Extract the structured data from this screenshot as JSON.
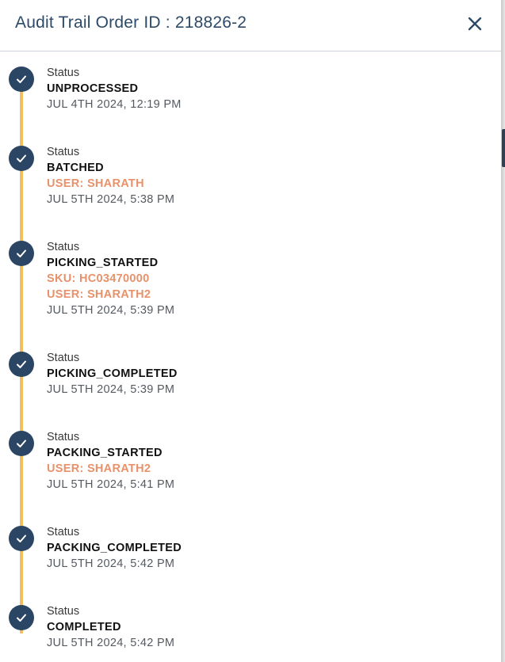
{
  "header": {
    "title": "Audit Trail Order ID : 218826-2",
    "close_icon": "close-icon"
  },
  "colors": {
    "title": "#2d4a66",
    "timeline_line": "#f0c060",
    "check_circle": "#2b4565",
    "user_sku_text": "#e8916a"
  },
  "entries": [
    {
      "label": "Status",
      "status": "UNPROCESSED",
      "details": [],
      "date": "JUL 4TH 2024, 12:19 PM"
    },
    {
      "label": "Status",
      "status": "BATCHED",
      "details": [
        "USER: SHARATH"
      ],
      "date": "JUL 5TH 2024, 5:38 PM"
    },
    {
      "label": "Status",
      "status": "PICKING_STARTED",
      "details": [
        "SKU: HC03470000",
        "USER: SHARATH2"
      ],
      "date": "JUL 5TH 2024, 5:39 PM"
    },
    {
      "label": "Status",
      "status": "PICKING_COMPLETED",
      "details": [],
      "date": "JUL 5TH 2024, 5:39 PM"
    },
    {
      "label": "Status",
      "status": "PACKING_STARTED",
      "details": [
        "USER: SHARATH2"
      ],
      "date": "JUL 5TH 2024, 5:41 PM"
    },
    {
      "label": "Status",
      "status": "PACKING_COMPLETED",
      "details": [],
      "date": "JUL 5TH 2024, 5:42 PM"
    },
    {
      "label": "Status",
      "status": "COMPLETED",
      "details": [],
      "date": "JUL 5TH 2024, 5:42 PM"
    }
  ]
}
